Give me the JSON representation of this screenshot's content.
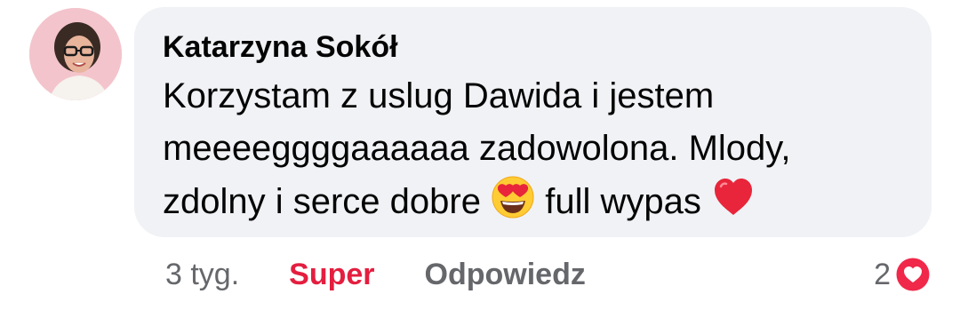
{
  "comment": {
    "author": "Katarzyna Sokół",
    "text_line1": "Korzystam z uslug Dawida i jestem",
    "text_line2": "meeeeggggaaaaaa zadowolona. Mlody,",
    "text_line3_start": "zdolny i serce dobre",
    "text_line3_mid": "full wypas",
    "emojis": [
      "heart-eyes-emoji",
      "red-heart-emoji"
    ]
  },
  "actions": {
    "time": "3 tyg.",
    "react_label": "Super",
    "reply_label": "Odpowiedz"
  },
  "reactions": {
    "count": "2",
    "icon": "love-reaction-icon"
  },
  "colors": {
    "bubble": "#f0f2f5",
    "react": "#e41e3f",
    "secondary": "#65676b"
  }
}
